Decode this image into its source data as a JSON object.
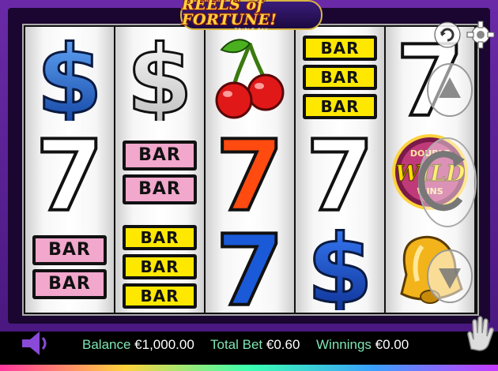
{
  "logo": {
    "title": "REELS of FORTUNE!",
    "subtitle": "TRIPLE PAY"
  },
  "reels": [
    [
      "dollar-blue",
      "seven-white",
      "bar-double-pink"
    ],
    [
      "dollar-white",
      "bar-double-pink",
      "bar-triple-yellow"
    ],
    [
      "cherries",
      "seven-red",
      "seven-blue"
    ],
    [
      "bar-triple-yellow",
      "seven-white",
      "dollar-blue"
    ],
    [
      "seven-white",
      "double-wild",
      "bell"
    ]
  ],
  "symbols": {
    "bar_label": "BAR",
    "wild_top": "DOUBLE",
    "wild_main": "WILD",
    "wild_bottom": "WINS"
  },
  "status": {
    "balance_label": "Balance",
    "balance_value": "€1,000.00",
    "total_bet_label": "Total Bet",
    "total_bet_value": "€0.60",
    "winnings_label": "Winnings",
    "winnings_value": "€0.00"
  },
  "icons": {
    "top_left_control": "replay-icon",
    "settings": "gear-icon",
    "bet_up": "arrow-up-icon",
    "spin": "spin-icon",
    "bet_down": "arrow-down-icon",
    "sound": "speaker-icon",
    "stop": "hand-icon"
  },
  "colors": {
    "frame": "#5a2294",
    "status_label": "#7fe6b4",
    "status_value": "#ffffff",
    "bar_yellow": "#ffe800",
    "bar_pink": "#f2a7cc",
    "seven_red": "#ff4a10",
    "seven_blue": "#1a5ad8"
  }
}
